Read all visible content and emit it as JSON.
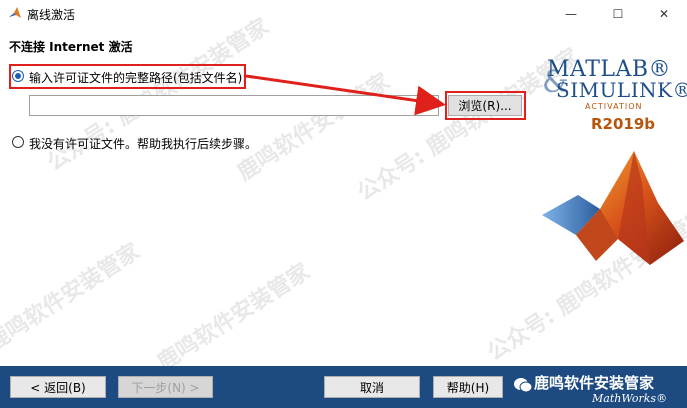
{
  "window": {
    "title": "离线激活",
    "minimize_glyph": "—",
    "maximize_glyph": "☐",
    "close_glyph": "✕"
  },
  "page": {
    "heading": "不连接 Internet 激活"
  },
  "options": {
    "option1_label": "输入许可证文件的完整路径(包括文件名):",
    "option2_label": "我没有许可证文件。帮助我执行后续步骤。",
    "selected": "option1"
  },
  "path_input": {
    "value": ""
  },
  "browse_button": {
    "label": "浏览(R)..."
  },
  "logo": {
    "line1": "MATLAB®",
    "line2": "SIMULINK®",
    "ampersand": "&",
    "subtitle": "ACTIVATION",
    "release": "R2019b"
  },
  "watermark": {
    "text1": "公众号: 鹿鸣软件安装管家",
    "text2": "鹿鸣软件安装管家"
  },
  "footer": {
    "back_label": "< 返回(B)",
    "next_label": "下一步(N) >",
    "cancel_label": "取消",
    "help_label": "帮助(H)",
    "brand_text": "鹿鸣软件安装管家",
    "mathworks_text": "MathWorks®"
  },
  "colors": {
    "highlight": "#e0201a",
    "footer_bg": "#1d4a80",
    "logo_blue": "#1f4f8a",
    "logo_orange": "#b7560d"
  }
}
